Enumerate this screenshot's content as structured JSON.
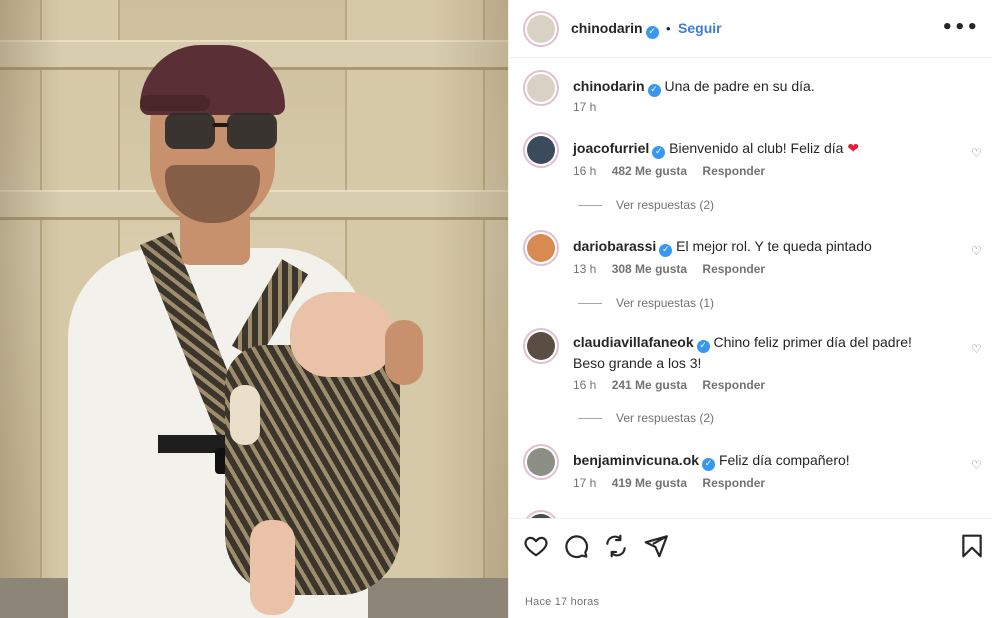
{
  "post": {
    "username": "chinodarin",
    "follow_label": "Seguir",
    "separator": "•",
    "more_label": "•••",
    "caption_user": "chinodarin",
    "caption_text": "Una de padre en su día.",
    "caption_time": "17 h",
    "footer_time": "Hace 17 horas"
  },
  "comments": [
    {
      "user": "joacofurriel",
      "text": "Bienvenido al club! Feliz día",
      "emoji": "❤",
      "time": "16 h",
      "likes": "482 Me gusta",
      "reply": "Responder",
      "replies": "Ver respuestas (2)",
      "avatar_color": "#3b4a5c"
    },
    {
      "user": "dariobarassi",
      "text": "El mejor rol. Y te queda pintado",
      "emoji": "",
      "time": "13 h",
      "likes": "308 Me gusta",
      "reply": "Responder",
      "replies": "Ver respuestas (1)",
      "avatar_color": "#d88a50"
    },
    {
      "user": "claudiavillafaneok",
      "text": "Chino feliz primer día del padre! Beso grande a los 3!",
      "emoji": "",
      "time": "16 h",
      "likes": "241 Me gusta",
      "reply": "Responder",
      "replies": "Ver respuestas (2)",
      "avatar_color": "#5a4e44"
    },
    {
      "user": "benjaminvicuna.ok",
      "text": "Feliz día compañero!",
      "emoji": "",
      "time": "17 h",
      "likes": "419 Me gusta",
      "reply": "Responder",
      "replies": "",
      "avatar_color": "#8c8f86"
    }
  ],
  "colors": {
    "follow": "#3d7bd6",
    "verified": "#3897f0",
    "heart": "#e0203c",
    "muted": "#737373"
  },
  "icons": [
    "heart-icon",
    "comment-icon",
    "share-icon",
    "send-icon",
    "bookmark-icon",
    "verified-icon",
    "more-options-icon"
  ]
}
